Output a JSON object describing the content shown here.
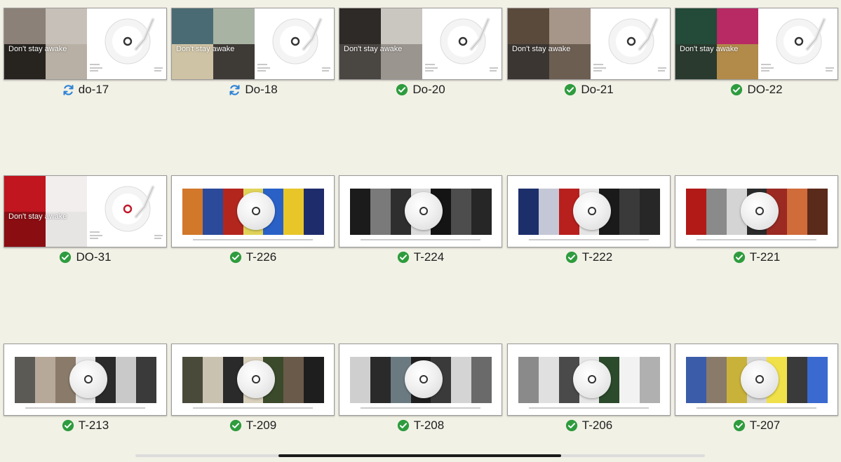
{
  "items": [
    {
      "label": "do-17",
      "status": "syncing",
      "kind": "do",
      "text": "Don't stay awake",
      "disc_center": "#333333",
      "tiles": [
        "#8b8178",
        "#c7c0b8",
        "#27231f",
        "#b8b0a4"
      ]
    },
    {
      "label": "Do-18",
      "status": "syncing",
      "kind": "do",
      "text": "Don't stay awake",
      "disc_center": "#333333",
      "tiles": [
        "#4a6b73",
        "#a8b3a4",
        "#cfc3a5",
        "#3e3a36"
      ]
    },
    {
      "label": "Do-20",
      "status": "done",
      "kind": "do",
      "text": "Don't stay awake",
      "disc_center": "#333333",
      "tiles": [
        "#2d2a27",
        "#cac6c0",
        "#4a4642",
        "#9b958f"
      ]
    },
    {
      "label": "Do-21",
      "status": "done",
      "kind": "do",
      "text": "Don't stay awake",
      "disc_center": "#333333",
      "tiles": [
        "#5a4a3c",
        "#a6968a",
        "#3b3632",
        "#6d5e52"
      ]
    },
    {
      "label": "DO-22",
      "status": "done",
      "kind": "do",
      "text": "Don't stay awake",
      "disc_center": "#333333",
      "tiles": [
        "#244a3a",
        "#b82a63",
        "#2a3a2e",
        "#b28a4a"
      ]
    },
    {
      "label": "DO-31",
      "status": "done",
      "kind": "do",
      "text": "Don't stay awake",
      "disc_center": "#c0182a",
      "tiles": [
        "#c11520",
        "#f2eeee",
        "#8a0d12",
        "#e7e4e4"
      ]
    },
    {
      "label": "T-226",
      "status": "done",
      "kind": "t",
      "strip": [
        "#d1782b",
        "#2b4a9a",
        "#b3261e",
        "#e0d35a",
        "#2a61c6",
        "#e8c62a",
        "#1f2c6b"
      ]
    },
    {
      "label": "T-224",
      "status": "done",
      "kind": "t",
      "strip": [
        "#1b1b1b",
        "#7a7a7a",
        "#2e2e2e",
        "#dcdcdc",
        "#141414",
        "#4d4d4d",
        "#262626"
      ]
    },
    {
      "label": "T-222",
      "status": "done",
      "kind": "t",
      "strip": [
        "#1c2f6b",
        "#c4c8d6",
        "#b8201d",
        "#e4e4e4",
        "#1a1a1a",
        "#3a3a3a",
        "#272727"
      ]
    },
    {
      "label": "T-221",
      "status": "done",
      "kind": "t",
      "strip": [
        "#b11a17",
        "#8a8a8a",
        "#d4d4d4",
        "#2b2b2b",
        "#9a2a22",
        "#d06b3a",
        "#5a2a1a"
      ]
    },
    {
      "label": "T-213",
      "status": "done",
      "kind": "t",
      "strip": [
        "#5c5a55",
        "#b7a99a",
        "#8a7a6a",
        "#e6e6e6",
        "#2b2b2b",
        "#c9c9c9",
        "#3a3a3a"
      ]
    },
    {
      "label": "T-209",
      "status": "done",
      "kind": "t",
      "strip": [
        "#4a4a3a",
        "#c9c2b0",
        "#2a2a2a",
        "#d8d0bc",
        "#3a4a2a",
        "#6a5a4a",
        "#1e1e1e"
      ]
    },
    {
      "label": "T-208",
      "status": "done",
      "kind": "t",
      "strip": [
        "#cfcfcf",
        "#2a2a2a",
        "#6a7a80",
        "#1f1f1f",
        "#3a3a3a",
        "#d4d4d4",
        "#6a6a6a"
      ]
    },
    {
      "label": "T-206",
      "status": "done",
      "kind": "t",
      "strip": [
        "#8a8a8a",
        "#e0e0e0",
        "#4a4a4a",
        "#e6e6e6",
        "#2c4a2c",
        "#f2f2f2",
        "#b0b0b0"
      ]
    },
    {
      "label": "T-207",
      "status": "done",
      "kind": "t",
      "strip": [
        "#3b5ca8",
        "#8a7a6a",
        "#c9b23a",
        "#d8d8d8",
        "#f0e04a",
        "#3a3a3a",
        "#3a6ad0"
      ]
    }
  ],
  "colors": {
    "done": "#2e9c3e",
    "syncing": "#2d83d6"
  }
}
